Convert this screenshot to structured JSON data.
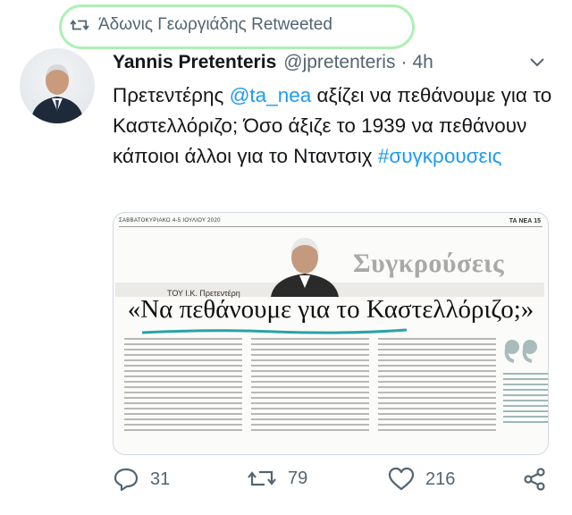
{
  "retweet": {
    "label": "Άδωνις Γεωργιάδης Retweeted"
  },
  "tweet": {
    "name": "Yannis Pretenteris",
    "handle": "@jpretenteris",
    "dot": "·",
    "time": "4h",
    "text_parts": {
      "p1": "Πρετεντέρης ",
      "mention": "@ta_nea",
      "p2": " αξίζει να πεθάνουμε για το Καστελλόριζο; Όσο άξιζε το 1939 να πεθάνουν κάποιοι άλλοι για το Νταντσιχ ",
      "hashtag": "#συγκρουσεις"
    }
  },
  "newspaper": {
    "header_left": "ΣΑΒΒΑΤΟΚΥΡΙΑΚΟ 4-5 ΙΟΥΛΙΟΥ 2020",
    "header_right": "ΤΑ ΝΕΑ 15",
    "author": "ΤΟΥ Ι.Κ. Πρετεντέρη",
    "column_title": "Συγκρούσεις",
    "headline": "«Να πεθάνουμε για το Καστελλόριζο;»"
  },
  "actions": {
    "replies": "31",
    "retweets": "79",
    "likes": "216"
  },
  "colors": {
    "accent": "#1d9bf0",
    "muted": "#536471",
    "highlight_oval": "#aef0b3",
    "underline_teal": "#2aa3a3"
  }
}
